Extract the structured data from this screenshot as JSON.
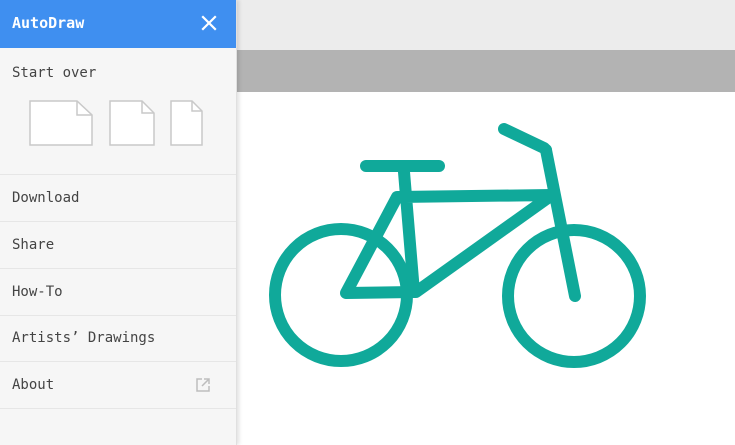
{
  "app": {
    "title": "AutoDraw"
  },
  "sidebar": {
    "start_over_label": "Start over",
    "page_sizes": [
      "landscape",
      "square",
      "portrait"
    ],
    "menu": [
      {
        "id": "download",
        "label": "Download"
      },
      {
        "id": "share",
        "label": "Share"
      },
      {
        "id": "how-to",
        "label": "How-To"
      },
      {
        "id": "artists-drawings",
        "label": "Artists’ Drawings"
      },
      {
        "id": "about",
        "label": "About",
        "icon": "external-link-icon"
      }
    ]
  },
  "canvas": {
    "drawing_name": "bicycle",
    "drawing_color": "#10a99a"
  },
  "colors": {
    "header": "#3f8ff0",
    "sidebar_bg": "#f6f6f6",
    "toolbar_strip": "#b3b3b3",
    "topbar": "#ececec"
  }
}
